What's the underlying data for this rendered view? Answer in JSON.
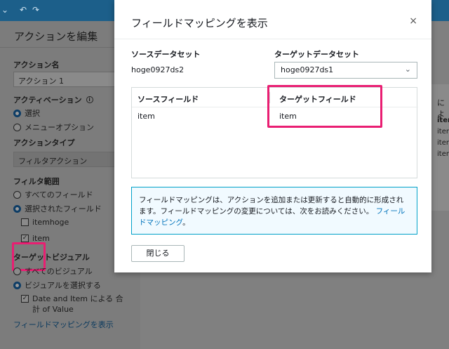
{
  "topbar": {
    "icons": [
      "chevron-down-icon",
      "undo-icon",
      "redo-icon"
    ]
  },
  "left_panel": {
    "title": "アクションを編集",
    "action_name_label": "アクション名",
    "action_name_value": "アクション 1",
    "activation_label": "アクティベーション",
    "activation_info": "i",
    "activation_options": [
      "選択",
      "メニューオプション"
    ],
    "action_type_label": "アクションタイプ",
    "action_type_value": "フィルタアクション",
    "filter_scope_label": "フィルタ範囲",
    "filter_scope_options": [
      "すべてのフィールド",
      "選択されたフィールド"
    ],
    "fields": [
      "itemhoge",
      "item"
    ],
    "target_visual_label": "ターゲットビジュアル",
    "target_visual_options": [
      "すべてのビジュアル",
      "ビジュアルを選択する"
    ],
    "visual_item": "Date and Item による 合計 of Value",
    "view_mapping_link": "フィールドマッピングを表示"
  },
  "right_panel": {
    "snippets": [
      "によ",
      "item",
      "item",
      "item",
      "item"
    ]
  },
  "modal": {
    "title": "フィールドマッピングを表示",
    "close": "×",
    "source_dataset_label": "ソースデータセット",
    "source_dataset_value": "hoge0927ds2",
    "target_dataset_label": "ターゲットデータセット",
    "target_dataset_value": "hoge0927ds1",
    "table_headers": [
      "ソースフィールド",
      "ターゲットフィールド"
    ],
    "rows": [
      [
        "item",
        "item"
      ]
    ],
    "notice_text": "フィールドマッピングは、アクションを追加または更新すると自動的に形成されます。フィールドマッピングの変更については、次をお読みください。",
    "notice_link": "フィールドマッピング",
    "notice_end": "。",
    "close_button": "閉じる"
  },
  "colors": {
    "accent": "#0073bb",
    "highlight": "#e91e72",
    "topbar": "#1c5f8a"
  }
}
